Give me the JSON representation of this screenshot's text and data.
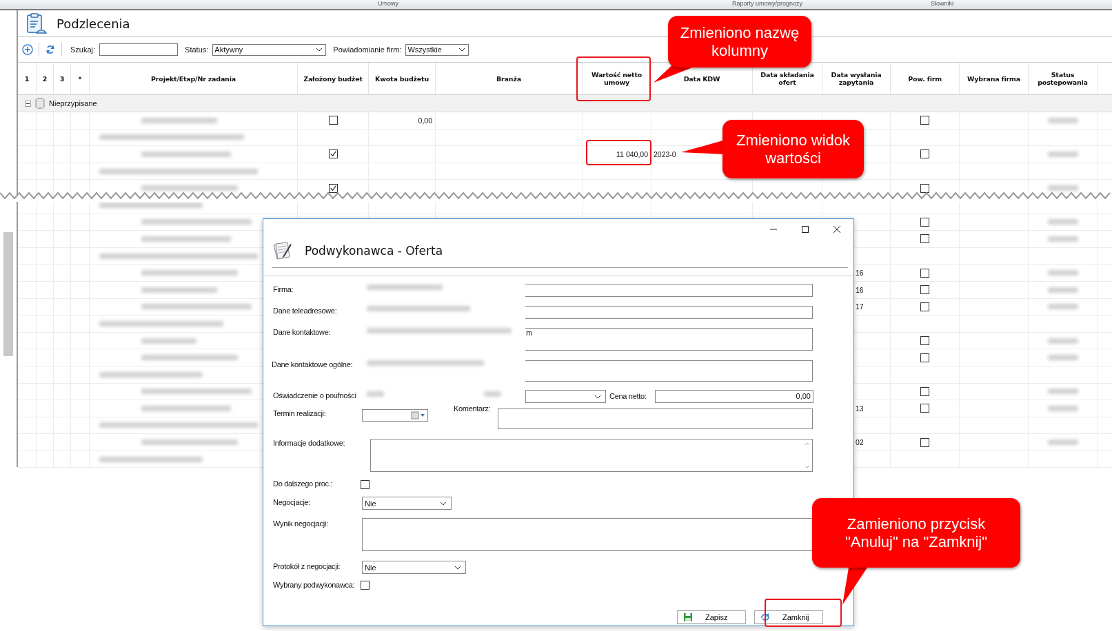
{
  "ribbon_tabs": [
    "Umowy",
    "Raporty umowy/prognozy",
    "Słowniki"
  ],
  "window": {
    "title": "Podzlecenia"
  },
  "toolbar": {
    "search_label": "Szukaj:",
    "status_label": "Status:",
    "status_value": "Aktywny",
    "notify_label": "Powiadomianie firm:",
    "notify_value": "Wszystkie"
  },
  "table": {
    "columns": [
      "1",
      "2",
      "3",
      "*",
      "Projekt/Etap/Nr zadania",
      "Założony budżet",
      "Kwota budżetu",
      "Branża",
      "Wartość netto umowy",
      "Data KDW",
      "Data składania ofert",
      "Data wysłania zapytania",
      "Pow. firm",
      "Wybrana firma",
      "Status postepowania"
    ],
    "group": {
      "label": "Nieprzypisane",
      "expanded": true
    },
    "rows_top": [
      {
        "kind": "task",
        "budget_set": false,
        "amount": "0,00",
        "notify": false
      },
      {
        "kind": "group"
      },
      {
        "kind": "task",
        "budget_set": true,
        "net_value": "11 040,00",
        "kdw_date": "2023-0",
        "notify": false
      },
      {
        "kind": "group"
      },
      {
        "kind": "task",
        "budget_set": true,
        "notify": false
      }
    ],
    "rows_bottom": [
      {
        "kind": "group"
      },
      {
        "kind": "task",
        "notify": false
      },
      {
        "kind": "task",
        "notify": false
      },
      {
        "kind": "group"
      },
      {
        "kind": "task",
        "sent_date": "16",
        "notify": false
      },
      {
        "kind": "task",
        "sent_date": "16",
        "notify": false
      },
      {
        "kind": "task",
        "sent_date": "17",
        "notify": false
      },
      {
        "kind": "group"
      },
      {
        "kind": "task",
        "notify": false
      },
      {
        "kind": "task",
        "notify": false
      },
      {
        "kind": "group"
      },
      {
        "kind": "task",
        "notify": false
      },
      {
        "kind": "task",
        "sent_date": "13",
        "notify": false
      },
      {
        "kind": "group"
      },
      {
        "kind": "task",
        "sent_date": "02",
        "notify": false
      },
      {
        "kind": "group"
      }
    ]
  },
  "dialog": {
    "title": "Podwykonawca - Oferta",
    "firm_label": "Firma:",
    "address_label": "Dane teleadresowe:",
    "contact_label": "Dane kontaktowe:",
    "contact_value": "m",
    "general_contact_label": "Dane kontaktowe ogólne:",
    "confidentiality_label": "Oświadczenie o poufności",
    "price_label": "Cena netto:",
    "price_value": "0,00",
    "deadline_label": "Termin realizacji:",
    "comment_label": "Komentarz:",
    "info_label": "Informacje dodatkowe:",
    "further_label": "Do dalszego proc.:",
    "further_checked": false,
    "negotiation_label": "Negocjacje:",
    "negotiation_value": "Nie",
    "result_label": "Wynik negocjacji:",
    "protocol_label": "Protokół z negocjacji:",
    "protocol_value": "Nie",
    "chosen_label": "Wybrany podwykonawca:",
    "chosen_checked": false,
    "save_button": "Zapisz",
    "close_button": "Zamknij"
  },
  "annotations": [
    {
      "text": "Zmieniono nazwę kolumny"
    },
    {
      "text": "Zmieniono widok wartości"
    },
    {
      "text": "Zamieniono przycisk \"Anuluj\" na \"Zamknij\""
    }
  ]
}
